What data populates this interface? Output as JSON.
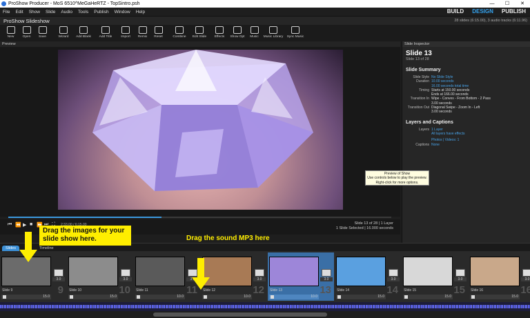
{
  "window": {
    "title": "ProShow Producer - MoS 6510^MeGaHeRTZ - TopSintro.psh",
    "controls": [
      "—",
      "☐",
      "✕"
    ]
  },
  "menu": [
    "File",
    "Edit",
    "Show",
    "Slide",
    "Audio",
    "Tools",
    "Publish",
    "Window",
    "Help"
  ],
  "modes": {
    "build": "BUILD",
    "design": "DESIGN",
    "publish": "PUBLISH"
  },
  "project": {
    "name": "ProShow Slideshow",
    "stats": "28 slides (6:15.00), 3 audio tracks (6:11.96)"
  },
  "toolbar": [
    {
      "label": "New",
      "icon": "new-icon"
    },
    {
      "label": "Open",
      "icon": "open-icon"
    },
    {
      "label": "Save",
      "icon": "save-icon"
    },
    {
      "label": "Wizard",
      "icon": "wizard-icon"
    },
    {
      "label": "Add Blank",
      "icon": "add-blank-icon"
    },
    {
      "label": "Add Title",
      "icon": "add-title-icon"
    },
    {
      "label": "Import",
      "icon": "import-icon"
    },
    {
      "label": "Remix",
      "icon": "remix-icon"
    },
    {
      "label": "Reset",
      "icon": "reset-icon"
    },
    {
      "label": "Combine",
      "icon": "combine-icon"
    },
    {
      "label": "Edit Slide",
      "icon": "edit-slide-icon"
    },
    {
      "label": "Effects",
      "icon": "effects-icon"
    },
    {
      "label": "Show Opt",
      "icon": "show-options-icon"
    },
    {
      "label": "Music",
      "icon": "music-icon"
    },
    {
      "label": "Music Library",
      "icon": "music-library-icon"
    },
    {
      "label": "Sync Music",
      "icon": "sync-music-icon"
    }
  ],
  "preview": {
    "label": "Preview",
    "progress": 0.4,
    "time": "2:33.00 / 6:15.00",
    "slide_status_1": "Slide 13 of 28  |  1 Layer",
    "slide_status_2": "1 Slide Selected  |  16.000 seconds"
  },
  "inspector": {
    "header": "Slide Inspector",
    "title": "Slide 13",
    "subtitle": "Slide 13 of 28",
    "summary_title": "Slide Summary",
    "style_label": "Slide Style",
    "style_value": "No Slide Style",
    "duration_label": "Duration",
    "duration_value": "10.00 seconds",
    "duration_total": "16.00 seconds total time",
    "timing_label": "Timing",
    "timing_start": "Starts at 150.00 seconds",
    "timing_end": "Ends at 166.00 seconds",
    "trin_label": "Transition In",
    "trin_value": "Wipe - Convex - From Bottom - 2 Pass",
    "trin_dur": "3.00 seconds",
    "trout_label": "Transition Out",
    "trout_value": "Diagonal Swipe - Zoom In - Left",
    "trout_dur": "3.00 seconds",
    "layers_title": "Layers and Captions",
    "layers_label": "Layers",
    "layers_value": "1 Layer",
    "layers_effects": "All layers have effects",
    "photos_value": "Photos | Videos: 1",
    "captions_label": "Captions",
    "captions_value": "None"
  },
  "tooltip": {
    "line1": "Preview of Show",
    "line2": "Use controls below to play the preview.",
    "line3": "Right-click for more options."
  },
  "timeline": {
    "tab_slides": "Slides",
    "tab_timeline": "Timeline",
    "slides": [
      {
        "name": "Slide 9",
        "num": "9",
        "dur": "15.0",
        "color": "#6b6b6b"
      },
      {
        "name": "Slide 10",
        "num": "10",
        "dur": "15.0",
        "color": "#8c8c8c"
      },
      {
        "name": "Slide 11",
        "num": "11",
        "dur": "10.0",
        "color": "#5a5a5a"
      },
      {
        "name": "Slide 12",
        "num": "12",
        "dur": "10.0",
        "color": "#a87a55"
      },
      {
        "name": "Slide 13",
        "num": "13",
        "dur": "10.0",
        "color": "#9d86d9"
      },
      {
        "name": "Slide 14",
        "num": "14",
        "dur": "15.0",
        "color": "#5aa0e0"
      },
      {
        "name": "Slide 15",
        "num": "15",
        "dur": "15.0",
        "color": "#d8d8d8"
      },
      {
        "name": "Slide 16",
        "num": "16",
        "dur": "15.0",
        "color": "#c9a88a"
      }
    ],
    "transitions": [
      "3.0",
      "3.0",
      "3.0",
      "3.0",
      "3.0",
      "3.0",
      "3.0",
      "3.0"
    ]
  },
  "callouts": {
    "images": "Drag the images for your slide show here.",
    "music": "Drag the sound MP3 here"
  }
}
